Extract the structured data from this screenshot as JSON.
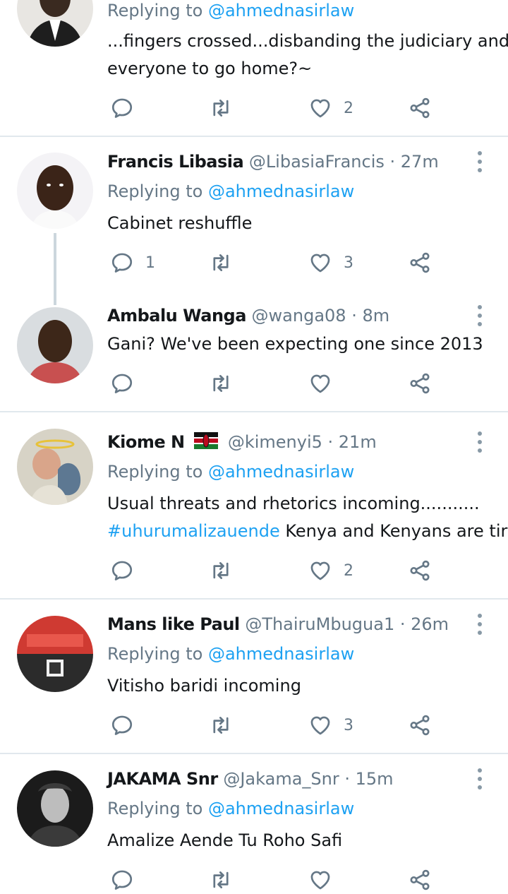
{
  "tweets": [
    {
      "replying_label": "Replying to",
      "replying_handle": "@ahmednasirlaw",
      "text_lines": [
        "...fingers crossed...disbanding the judiciary and",
        "everyone to go home?~"
      ],
      "likes": "2"
    },
    {
      "name": "Francis Libasia",
      "handle": "@LibasiaFrancis",
      "time": "· 27m",
      "replying_label": "Replying to",
      "replying_handle": "@ahmednasirlaw",
      "text": "Cabinet reshuffle",
      "replies": "1",
      "likes": "3"
    },
    {
      "name": "Ambalu Wanga",
      "handle": "@wanga08",
      "time": "· 8m",
      "text": "Gani? We've been expecting one since 2013"
    },
    {
      "name": "Kiome N",
      "handle": "@kimenyi5",
      "time": "· 21m",
      "replying_label": "Replying to",
      "replying_handle": "@ahmednasirlaw",
      "text_line1": "Usual threats and rhetorics incoming...........",
      "hashtag": "#uhurumalizauende",
      "text_line2_rest": " Kenya and Kenyans are tired",
      "likes": "2"
    },
    {
      "name": "Mans like Paul",
      "handle": "@ThairuMbugua1",
      "time": "· 26m",
      "replying_label": "Replying to",
      "replying_handle": "@ahmednasirlaw",
      "text": "Vitisho baridi incoming",
      "likes": "3"
    },
    {
      "name": "JAKAMA Snr",
      "handle": "@Jakama_Snr",
      "time": "· 15m",
      "replying_label": "Replying to",
      "replying_handle": "@ahmednasirlaw",
      "text": "Amalize Aende Tu Roho Safi"
    }
  ],
  "colors": {
    "accent": "#1da1f2",
    "muted": "#657786",
    "divider": "#e1e8ed"
  }
}
